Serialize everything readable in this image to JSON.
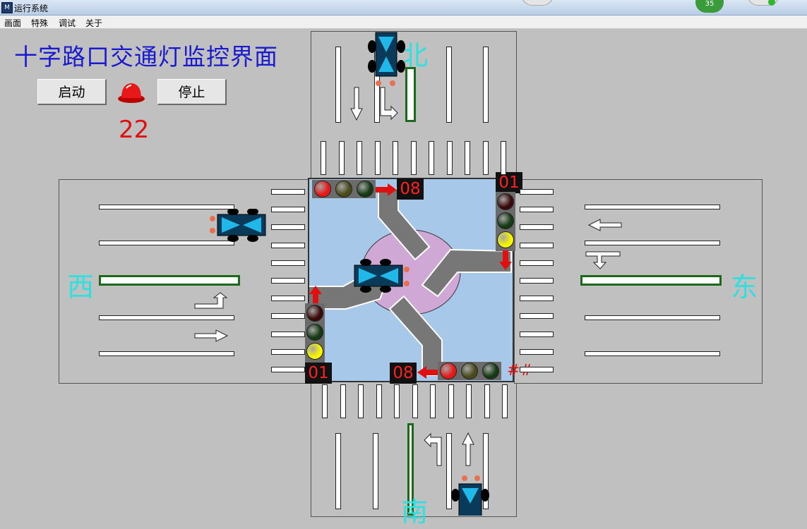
{
  "window": {
    "title": "运行系统",
    "app_icon": "app-icon"
  },
  "menu": [
    "画面",
    "特殊",
    "调试",
    "关于"
  ],
  "taskbar": {
    "badge": "35"
  },
  "heading": "十字路口交通灯监控界面",
  "controls": {
    "start_label": "启动",
    "stop_label": "停止",
    "counter": "22",
    "alarm_icon": "alarm-beacon-icon"
  },
  "directions": {
    "north": "北",
    "south": "南",
    "east": "东",
    "west": "西"
  },
  "timers": {
    "top": "08",
    "right_top": "01",
    "left_bottom": "01",
    "bottom": "08"
  },
  "hash_text": "##",
  "colors": {
    "red": "#e01010",
    "amber_off": "#4a4a1a",
    "green_off": "#133a13",
    "red_off": "#3a0a0a",
    "yellow": "#f5f500",
    "lane_green": "#1b6a1b",
    "center_bg": "#a8c8ea",
    "roundabout": "#d0a8d6"
  },
  "lights": {
    "top": [
      "red",
      "amber_off",
      "green_off"
    ],
    "right": [
      "red_off",
      "green_off",
      "yellow"
    ],
    "left": [
      "red_off",
      "green_off",
      "yellow"
    ],
    "bottom": [
      "red",
      "amber_off",
      "green_off"
    ]
  }
}
